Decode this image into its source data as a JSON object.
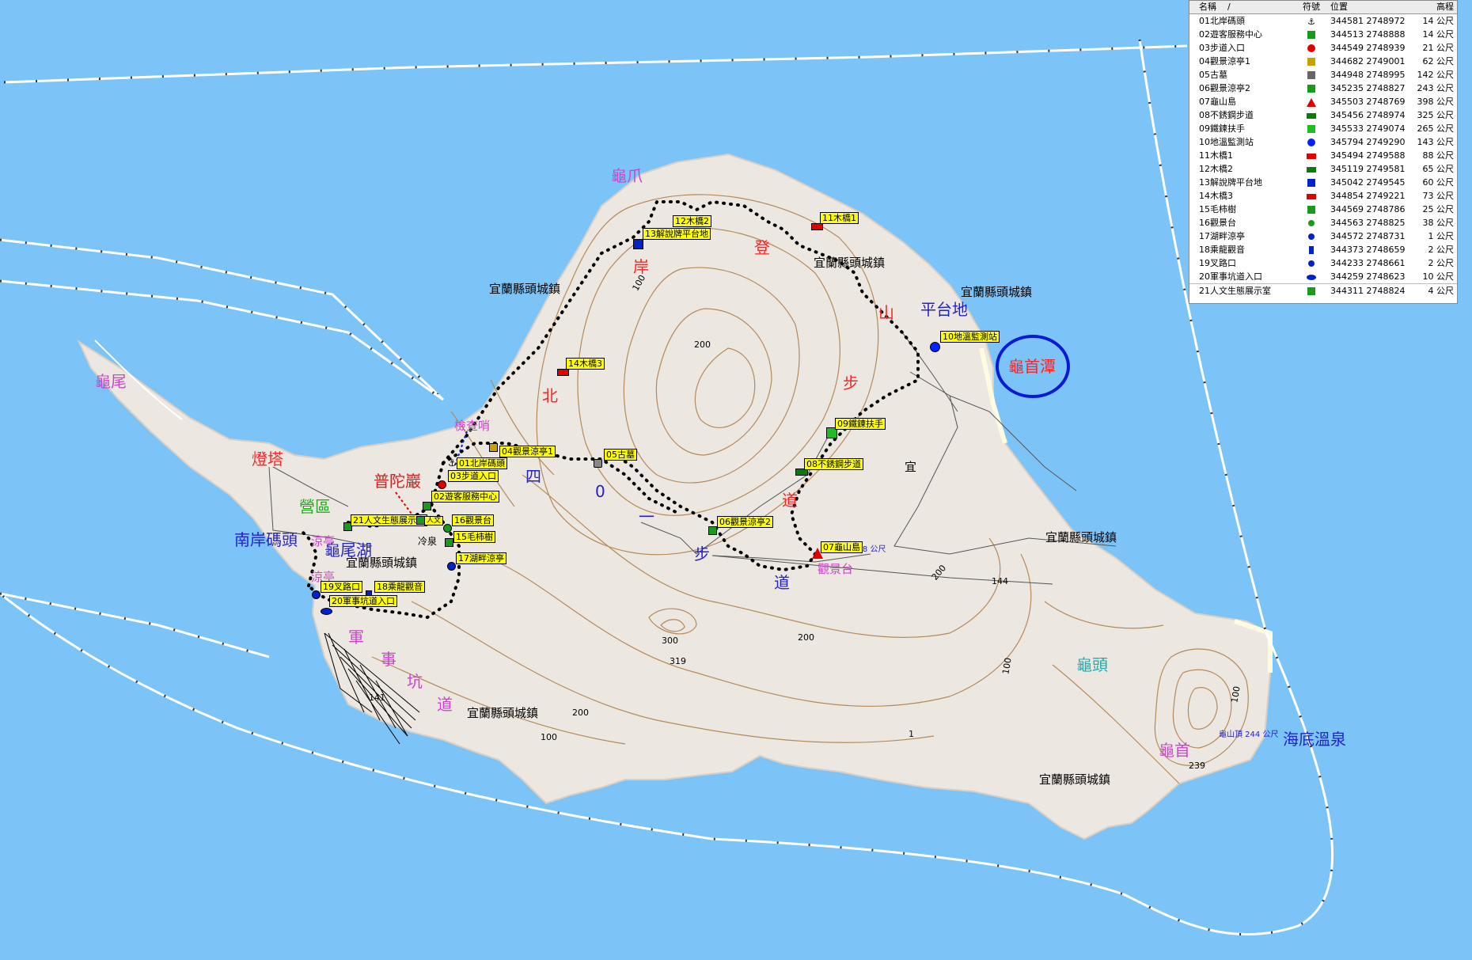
{
  "legend": {
    "headers": {
      "name": "名稱",
      "sort": "/",
      "symbol": "符號",
      "position": "位置",
      "elevation": "高程"
    },
    "rows": [
      {
        "name": "01北岸碼頭",
        "pos": "344581 2748972",
        "elev": "14 公尺",
        "icon": "anchor-icon",
        "color": "#000000"
      },
      {
        "name": "02遊客服務中心",
        "pos": "344513 2748888",
        "elev": "14 公尺",
        "icon": "house-icon",
        "color": "#1a9a1a"
      },
      {
        "name": "03步道入口",
        "pos": "344549 2748939",
        "elev": "21 公尺",
        "icon": "dot-icon",
        "color": "#e00000"
      },
      {
        "name": "04觀景涼亭1",
        "pos": "344682 2749001",
        "elev": "62 公尺",
        "icon": "pavilion-icon",
        "color": "#c8a000"
      },
      {
        "name": "05古墓",
        "pos": "344948 2748995",
        "elev": "142 公尺",
        "icon": "tomb-icon",
        "color": "#666666"
      },
      {
        "name": "06觀景涼亭2",
        "pos": "345235 2748827",
        "elev": "243 公尺",
        "icon": "house-icon",
        "color": "#1a9a1a"
      },
      {
        "name": "07龜山島",
        "pos": "345503 2748769",
        "elev": "398 公尺",
        "icon": "triangle-icon",
        "color": "#e00000"
      },
      {
        "name": "08不銹鋼步道",
        "pos": "345456 2748974",
        "elev": "325 公尺",
        "icon": "rect-icon",
        "color": "#0a7a0a"
      },
      {
        "name": "09鐵鍊扶手",
        "pos": "345533 2749074",
        "elev": "265 公尺",
        "icon": "cube-icon",
        "color": "#22bb22"
      },
      {
        "name": "10地溫監測站",
        "pos": "345794 2749290",
        "elev": "143 公尺",
        "icon": "circle-icon",
        "color": "#0022ff"
      },
      {
        "name": "11木橋1",
        "pos": "345494 2749588",
        "elev": "88 公尺",
        "icon": "rect-icon",
        "color": "#e00000"
      },
      {
        "name": "12木橋2",
        "pos": "345119 2749581",
        "elev": "65 公尺",
        "icon": "rect-icon",
        "color": "#0a7a0a"
      },
      {
        "name": "13解說牌平台地",
        "pos": "345042 2749545",
        "elev": "60 公尺",
        "icon": "square-icon",
        "color": "#0022cc"
      },
      {
        "name": "14木橋3",
        "pos": "344854 2749221",
        "elev": "73 公尺",
        "icon": "rect-icon",
        "color": "#e00000"
      },
      {
        "name": "15毛柿樹",
        "pos": "344569 2748786",
        "elev": "25 公尺",
        "icon": "tree-icon",
        "color": "#1a9a1a"
      },
      {
        "name": "16觀景台",
        "pos": "344563 2748825",
        "elev": "38 公尺",
        "icon": "sun-icon",
        "color": "#1a9a1a"
      },
      {
        "name": "17湖畔涼亭",
        "pos": "344572 2748731",
        "elev": "1 公尺",
        "icon": "sun-icon",
        "color": "#0022cc"
      },
      {
        "name": "18乘龍觀音",
        "pos": "344373 2748659",
        "elev": "2 公尺",
        "icon": "statue-icon",
        "color": "#0022cc"
      },
      {
        "name": "19叉路口",
        "pos": "344233 2748661",
        "elev": "2 公尺",
        "icon": "sun-icon",
        "color": "#0022cc"
      },
      {
        "name": "20軍事坑道入口",
        "pos": "344259 2748623",
        "elev": "10 公尺",
        "icon": "ellipse-icon",
        "color": "#0022cc"
      },
      {
        "name": "21人文生態展示室",
        "pos": "344311 2748824",
        "elev": "4 公尺",
        "icon": "house-icon",
        "color": "#1a9a1a"
      }
    ]
  },
  "labels": [
    {
      "id": "guizhua",
      "text": "龜爪",
      "color": "#cc44cc"
    },
    {
      "id": "guiwei",
      "text": "龜尾",
      "color": "#cc44cc"
    },
    {
      "id": "dengta",
      "text": "燈塔",
      "color": "#ff2222"
    },
    {
      "id": "yingqu",
      "text": "營區",
      "color": "#22aa22"
    },
    {
      "id": "nanan",
      "text": "南岸碼頭",
      "color": "#2222cc"
    },
    {
      "id": "liangting1",
      "text": "涼亭",
      "color": "#cc44cc"
    },
    {
      "id": "liangting2",
      "text": "涼亭",
      "color": "#cc44cc"
    },
    {
      "id": "guiweihu",
      "text": "龜尾湖",
      "color": "#2222cc"
    },
    {
      "id": "putuoyan",
      "text": "普陀巖",
      "color": "#cc2222"
    },
    {
      "id": "jianchashao",
      "text": "檢查哨",
      "color": "#cc44cc"
    },
    {
      "id": "lengquan",
      "text": "冷泉",
      "color": "#000000"
    },
    {
      "id": "beian_bei",
      "text": "北",
      "color": "#ff2222"
    },
    {
      "id": "beian_an",
      "text": "岸",
      "color": "#ff2222"
    },
    {
      "id": "deng",
      "text": "登",
      "color": "#ff2222"
    },
    {
      "id": "shan",
      "text": "山",
      "color": "#ff2222"
    },
    {
      "id": "bu1",
      "text": "步",
      "color": "#ff2222"
    },
    {
      "id": "dao1",
      "text": "道",
      "color": "#ff2222"
    },
    {
      "id": "pingtaidi",
      "text": "平台地",
      "color": "#2222cc"
    },
    {
      "id": "guishoutan",
      "text": "龜首潭",
      "color": "#ff2222"
    },
    {
      "id": "si",
      "text": "四",
      "color": "#2222cc"
    },
    {
      "id": "ling",
      "text": "0",
      "color": "#2222cc"
    },
    {
      "id": "yi",
      "text": "一",
      "color": "#2222cc"
    },
    {
      "id": "bu2",
      "text": "步",
      "color": "#2222cc"
    },
    {
      "id": "dao2",
      "text": "道",
      "color": "#2222cc"
    },
    {
      "id": "guanjingtai",
      "text": "觀景台",
      "color": "#cc44cc"
    },
    {
      "id": "jun",
      "text": "軍",
      "color": "#cc44cc"
    },
    {
      "id": "shi",
      "text": "事",
      "color": "#cc44cc"
    },
    {
      "id": "keng",
      "text": "坑",
      "color": "#cc44cc"
    },
    {
      "id": "dao3",
      "text": "道",
      "color": "#cc44cc"
    },
    {
      "id": "guitou",
      "text": "龜頭",
      "color": "#22aaaa"
    },
    {
      "id": "guishou",
      "text": "龜首",
      "color": "#cc44cc"
    },
    {
      "id": "haidi",
      "text": "海底溫泉",
      "color": "#2222cc"
    },
    {
      "id": "yi2",
      "text": "宜",
      "color": "#000000"
    },
    {
      "id": "tc1",
      "text": "宜蘭縣頭城鎮",
      "color": "#000000"
    },
    {
      "id": "tc2",
      "text": "宜蘭縣頭城鎮",
      "color": "#000000"
    },
    {
      "id": "tc3",
      "text": "宜蘭縣頭城鎮",
      "color": "#000000"
    },
    {
      "id": "tc4",
      "text": "宜蘭縣頭城鎮",
      "color": "#000000"
    },
    {
      "id": "tc5",
      "text": "宜蘭縣頭城鎮",
      "color": "#000000"
    },
    {
      "id": "tc6",
      "text": "宜蘭縣頭城鎮",
      "color": "#000000"
    },
    {
      "id": "tc7",
      "text": "宜蘭縣頭城鎮",
      "color": "#000000"
    },
    {
      "id": "e200a",
      "text": "200",
      "color": "#000000"
    },
    {
      "id": "e200b",
      "text": "200",
      "color": "#000000"
    },
    {
      "id": "e200c",
      "text": "200",
      "color": "#000000"
    },
    {
      "id": "e200d",
      "text": "200",
      "color": "#000000"
    },
    {
      "id": "e100a",
      "text": "100",
      "color": "#000000"
    },
    {
      "id": "e100b",
      "text": "100",
      "color": "#000000"
    },
    {
      "id": "e100c",
      "text": "100",
      "color": "#000000"
    },
    {
      "id": "e100d",
      "text": "100",
      "color": "#000000"
    },
    {
      "id": "e300",
      "text": "300",
      "color": "#000000"
    },
    {
      "id": "e319",
      "text": "319",
      "color": "#000000"
    },
    {
      "id": "e144",
      "text": "144",
      "color": "#000000"
    },
    {
      "id": "e141",
      "text": "141",
      "color": "#000000"
    },
    {
      "id": "e239",
      "text": "239",
      "color": "#000000"
    },
    {
      "id": "e1",
      "text": "1",
      "color": "#000000"
    },
    {
      "id": "peak398",
      "text": "龜山島 398 公尺",
      "color": "#2222cc"
    },
    {
      "id": "peak244",
      "text": "龜山頂 244 公尺",
      "color": "#2222cc"
    }
  ],
  "pois": [
    {
      "id": "p01",
      "text": "01北岸碼頭",
      "color": "#000000",
      "icon": "anchor-icon"
    },
    {
      "id": "p02",
      "text": "02遊客服務中心",
      "color": "#1a9a1a",
      "icon": "house-icon"
    },
    {
      "id": "p03",
      "text": "03步道入口",
      "color": "#e00000",
      "icon": "dot-icon"
    },
    {
      "id": "p04",
      "text": "04觀景涼亭1",
      "color": "#c8a000",
      "icon": "pavilion-icon"
    },
    {
      "id": "p05",
      "text": "05古墓",
      "color": "#666666",
      "icon": "tomb-icon"
    },
    {
      "id": "p06",
      "text": "06觀景涼亭2",
      "color": "#1a9a1a",
      "icon": "house-icon"
    },
    {
      "id": "p07",
      "text": "07龜山島",
      "color": "#e00000",
      "icon": "triangle-icon"
    },
    {
      "id": "p08",
      "text": "08不銹鋼步道",
      "color": "#0a7a0a",
      "icon": "rect-icon"
    },
    {
      "id": "p09",
      "text": "09鐵鍊扶手",
      "color": "#22bb22",
      "icon": "cube-icon"
    },
    {
      "id": "p10",
      "text": "10地溫監測站",
      "color": "#0022ff",
      "icon": "circle-icon"
    },
    {
      "id": "p11",
      "text": "11木橋1",
      "color": "#e00000",
      "icon": "rect-icon"
    },
    {
      "id": "p12",
      "text": "12木橋2",
      "color": "#0a7a0a",
      "icon": "rect-icon"
    },
    {
      "id": "p13",
      "text": "13解說牌平台地",
      "color": "#0022cc",
      "icon": "square-icon"
    },
    {
      "id": "p14",
      "text": "14木橋3",
      "color": "#e00000",
      "icon": "rect-icon"
    },
    {
      "id": "p15",
      "text": "15毛柿樹",
      "color": "#1a9a1a",
      "icon": "tree-icon"
    },
    {
      "id": "p16",
      "text": "16觀景台",
      "color": "#1a9a1a",
      "icon": "sun-icon"
    },
    {
      "id": "p17",
      "text": "17湖畔涼亭",
      "color": "#0022cc",
      "icon": "sun-icon"
    },
    {
      "id": "p18",
      "text": "18乘龍觀音",
      "color": "#0022cc",
      "icon": "statue-icon"
    },
    {
      "id": "p19",
      "text": "19叉路口",
      "color": "#0022cc",
      "icon": "sun-icon"
    },
    {
      "id": "p20",
      "text": "20軍事坑道入口",
      "color": "#0022cc",
      "icon": "ellipse-icon"
    },
    {
      "id": "p21",
      "text": "21人文生態展示室",
      "color": "#1a9a1a",
      "icon": "house-icon"
    },
    {
      "id": "p21b",
      "text": "人文",
      "color": "#1a9a1a",
      "icon": "house-icon"
    }
  ],
  "colors": {
    "sea": "#7cc3f7",
    "land": "#ede7e1",
    "contour": "#b58a5a",
    "trail": "#000000",
    "poi_bg": "#ffff00"
  }
}
